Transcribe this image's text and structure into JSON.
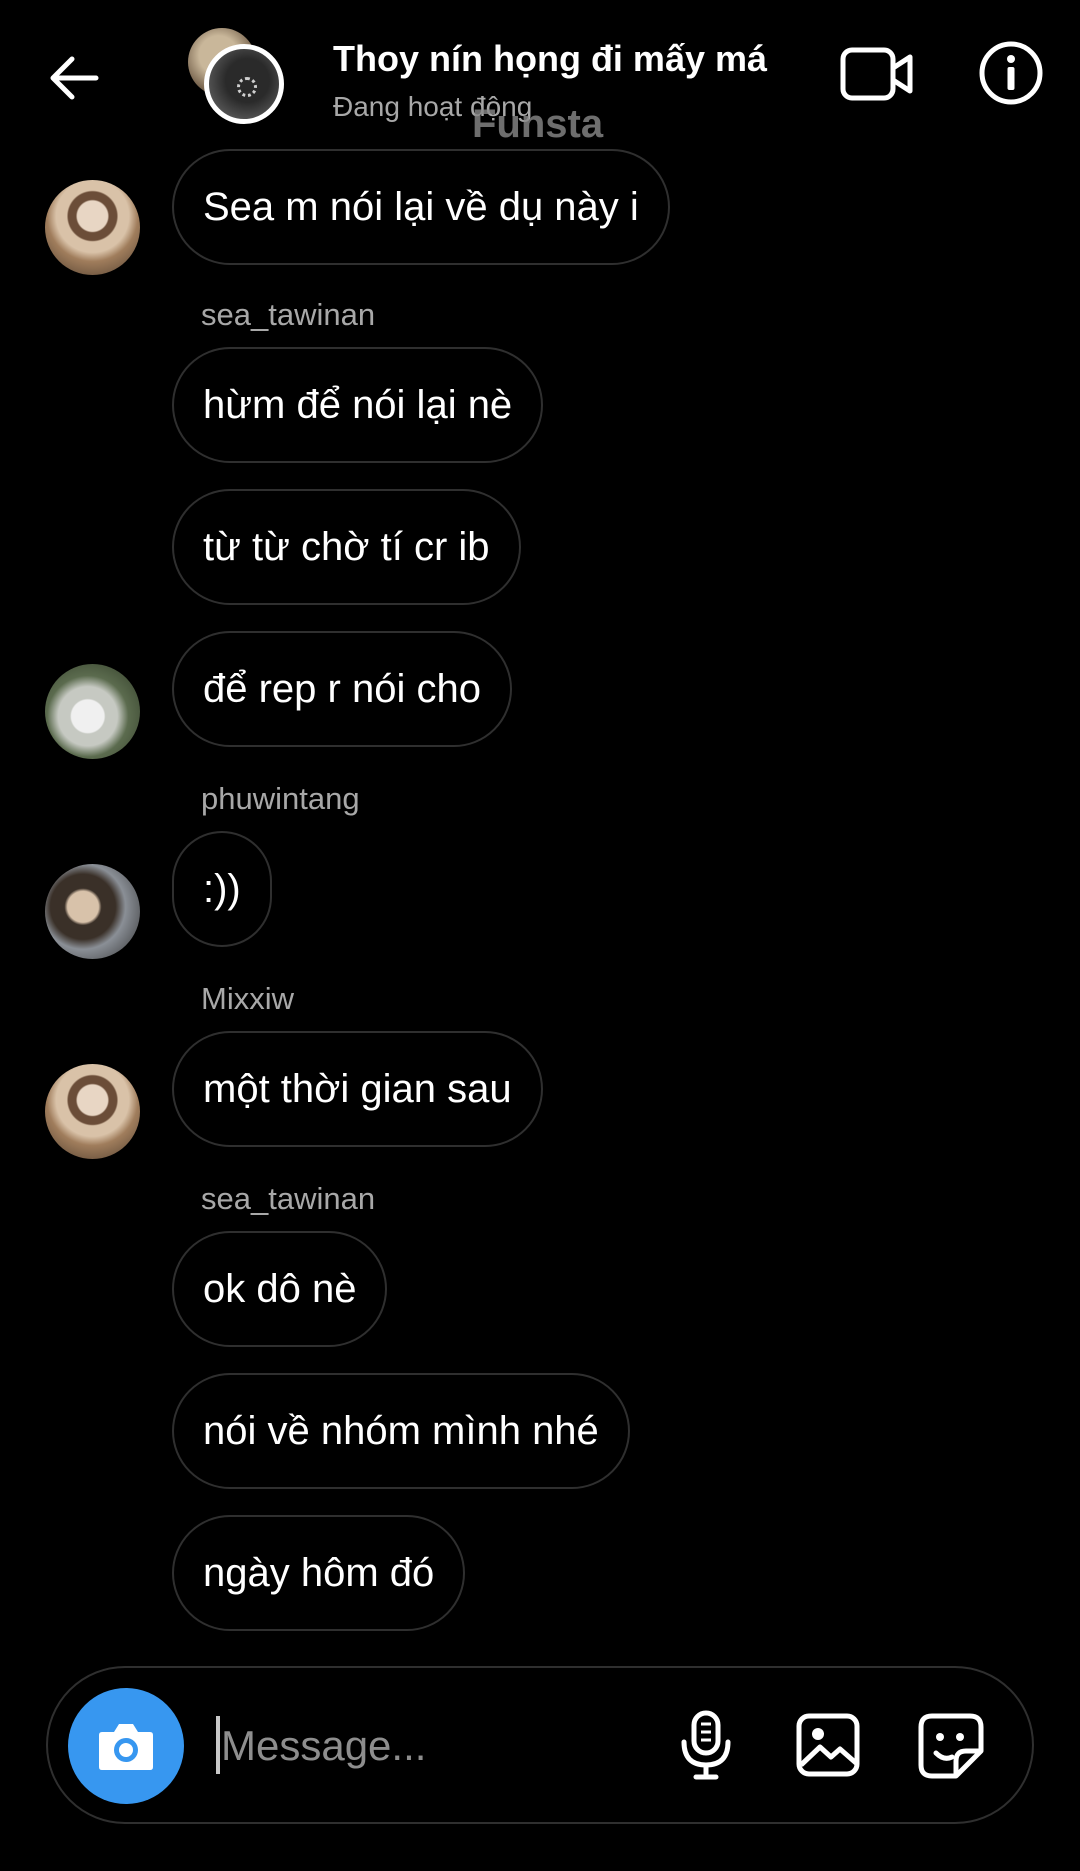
{
  "header": {
    "title": "Thoy nín họng đi mấy má",
    "status": "Đang hoạt động",
    "watermark": "Funsta"
  },
  "messages": [
    {
      "sender": "",
      "text": "Sea m nói lại về dụ này i"
    },
    {
      "sender": "sea_tawinan",
      "text": "hừm để nói lại nè"
    },
    {
      "sender": "",
      "text": "từ từ chờ tí cr ib"
    },
    {
      "sender": "",
      "text": "để rep r nói cho"
    },
    {
      "sender": "phuwintang",
      "text": ":))"
    },
    {
      "sender": "Mixxiw",
      "text": "một thời gian sau"
    },
    {
      "sender": "sea_tawinan",
      "text": "ok dô nè"
    },
    {
      "sender": "",
      "text": "nói về nhóm mình nhé"
    },
    {
      "sender": "",
      "text": "ngày hôm đó"
    }
  ],
  "composer": {
    "placeholder": "Message..."
  },
  "icons": {
    "back": "arrow-left-icon",
    "video": "video-camera-icon",
    "info": "info-icon",
    "camera": "camera-icon",
    "mic": "microphone-icon",
    "gallery": "image-icon",
    "sticker": "sticker-icon"
  },
  "colors": {
    "background": "#000000",
    "bubble_border": "#2f2f2f",
    "secondary_text": "#a8a8a8",
    "camera_button": "#3797f0"
  }
}
